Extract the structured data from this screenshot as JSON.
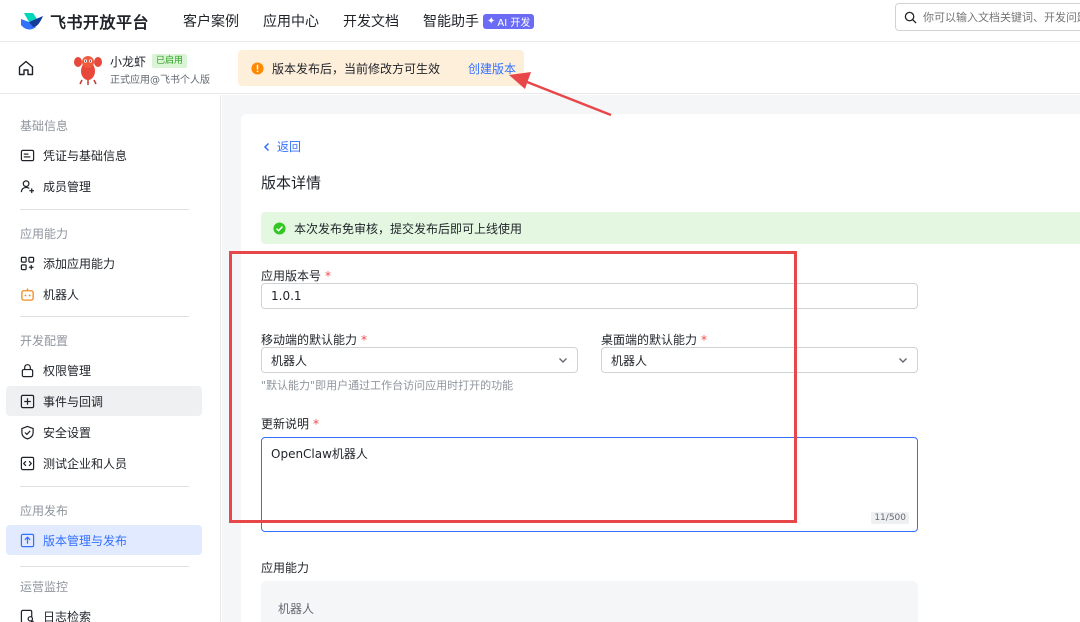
{
  "topnav": {
    "logo_text": "飞书开放平台",
    "items": [
      {
        "label": "客户案例"
      },
      {
        "label": "应用中心"
      },
      {
        "label": "开发文档"
      },
      {
        "label": "智能助手"
      }
    ],
    "ai_badge": "AI 开发",
    "search_placeholder": "你可以输入文档关键词、开发问题"
  },
  "app_header": {
    "app_name": "小龙虾",
    "status_badge": "已启用",
    "app_subtitle": "正式应用@飞书个人版",
    "notice_text": "版本发布后，当前修改方可生效",
    "notice_link": "创建版本"
  },
  "sidebar": {
    "sections": [
      {
        "title": "基础信息",
        "items": [
          {
            "label": "凭证与基础信息"
          },
          {
            "label": "成员管理"
          }
        ]
      },
      {
        "title": "应用能力",
        "items": [
          {
            "label": "添加应用能力"
          },
          {
            "label": "机器人"
          }
        ]
      },
      {
        "title": "开发配置",
        "items": [
          {
            "label": "权限管理"
          },
          {
            "label": "事件与回调"
          },
          {
            "label": "安全设置"
          },
          {
            "label": "测试企业和人员"
          }
        ]
      },
      {
        "title": "应用发布",
        "items": [
          {
            "label": "版本管理与发布"
          }
        ]
      },
      {
        "title": "运营监控",
        "items": [
          {
            "label": "日志检索"
          }
        ]
      }
    ]
  },
  "main": {
    "back_label": "返回",
    "page_title": "版本详情",
    "success_text": "本次发布免审核，提交发布后即可上线使用",
    "version_label": "应用版本号",
    "version_value": "1.0.1",
    "mobile_label": "移动端的默认能力",
    "mobile_value": "机器人",
    "desktop_label": "桌面端的默认能力",
    "desktop_value": "机器人",
    "hint": "\"默认能力\"即用户通过工作台访问应用时打开的功能",
    "notes_label": "更新说明",
    "notes_value": "OpenClaw机器人",
    "notes_counter": "11/500",
    "capability_label": "应用能力",
    "capability_item": "机器人",
    "required_mark": "*"
  },
  "colors": {
    "accent": "#3370ff",
    "annotation_red": "#e8474a",
    "warning_bg": "#feefdb",
    "success_bg": "#e4f8e1"
  }
}
